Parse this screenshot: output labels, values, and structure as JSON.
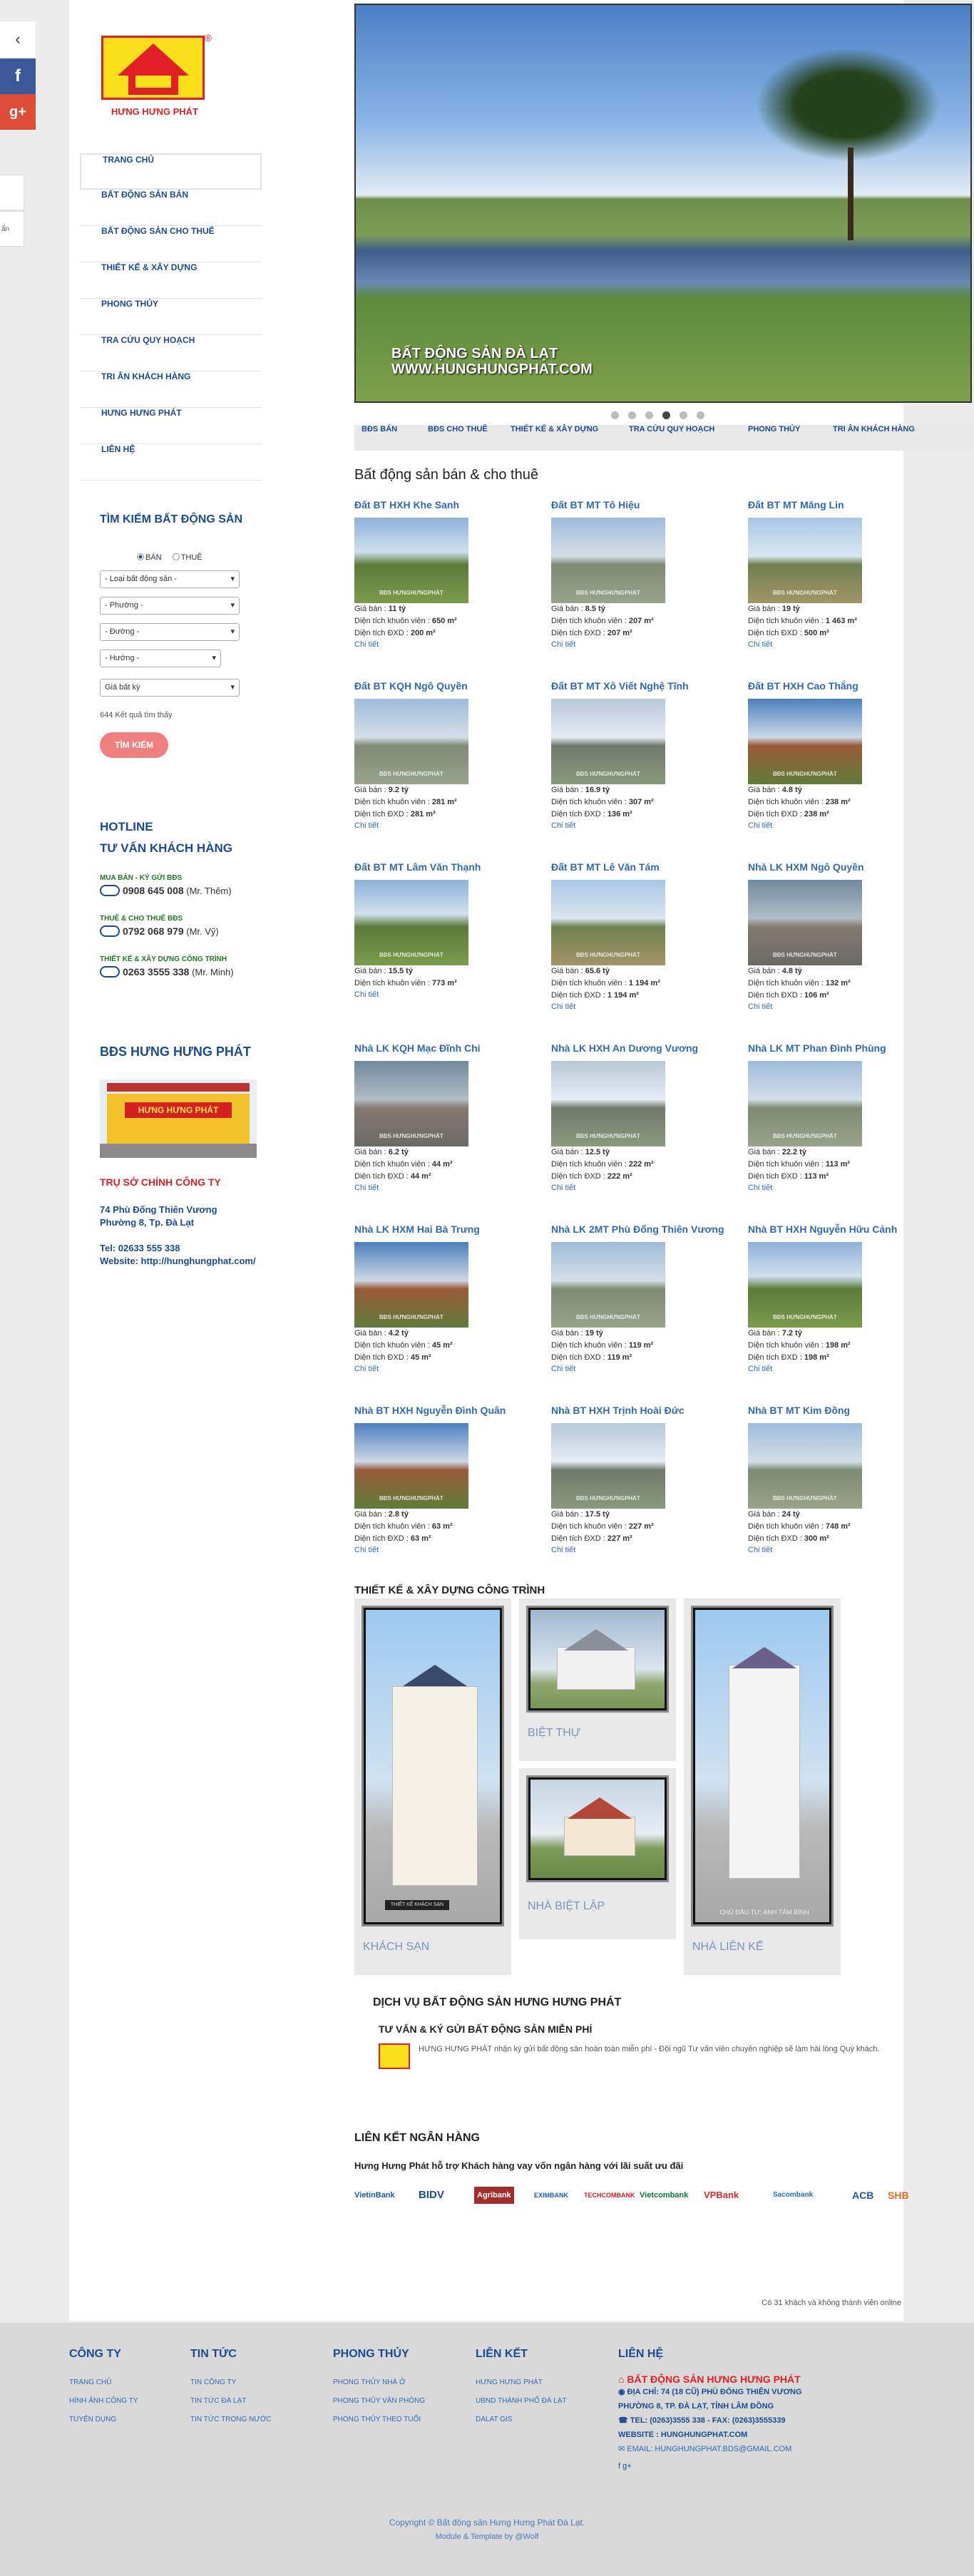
{
  "social": {
    "facebook": "f",
    "googleplus": "g+",
    "arrow": "‹",
    "tab2": "ẩn"
  },
  "logo": {
    "name": "HƯNG HƯNG PHÁT",
    "reg": "®"
  },
  "menu": [
    "TRANG CHỦ",
    "BẤT ĐỘNG SẢN BÁN",
    "BẤT ĐỘNG SẢN CHO THUÊ",
    "THIẾT KẾ & XÂY DỰNG",
    "PHONG THỦY",
    "TRA CỨU QUY HOẠCH",
    "TRI ÂN KHÁCH HÀNG",
    "HƯNG HƯNG PHÁT",
    "LIÊN HỆ"
  ],
  "search": {
    "title": "TÌM KIẾM BẤT ĐỘNG SẢN",
    "radio_ban": "BÁN",
    "radio_thue": "THUÊ",
    "type": "- Loại bất động sản -",
    "ward": "- Phường -",
    "street": "- Đường -",
    "direction": "- Hướng -",
    "price": "Giá bất kỳ",
    "results": "644 Kết quả tìm thấy",
    "button": "TÌM KIẾM"
  },
  "hotline": {
    "title1": "HOTLINE",
    "title2": "TƯ VẤN KHÁCH HÀNG",
    "g1_label": "MUA BÁN - KÝ GỬI BĐS",
    "g1_phone": "0908 645 008",
    "g1_name": "(Mr. Thêm)",
    "g2_label": "THUÊ & CHO THUÊ BĐS",
    "g2_phone": "0792 068 979",
    "g2_name": "(Mr. Vỹ)",
    "g3_label": "THIẾT KẾ & XÂY DỰNG CÔNG TRÌNH",
    "g3_phone": "0263 3555 338",
    "g3_name": "(Mr. Minh)"
  },
  "company": {
    "title": "BĐS HƯNG HƯNG PHÁT",
    "shop_sign": "HƯNG HƯNG PHÁT",
    "hq_title": "TRỤ SỞ CHÍNH CÔNG TY",
    "addr1": "74 Phù Đổng Thiên Vương",
    "addr2": "Phường 8, Tp. Đà Lạt",
    "tel": "Tel: 02633 555 338",
    "web": "Website: http://hunghungphat.com/"
  },
  "slider": {
    "caption1": "BẤT ĐỘNG SẢN ĐÀ LẠT",
    "caption2": "WWW.HUNGHUNGPHAT.COM",
    "active": 4,
    "count": 6
  },
  "catbar": [
    "BĐS BÁN",
    "BĐS CHO THUÊ",
    "THIẾT KẾ & XÂY DỰNG",
    "TRA CỨU QUY HOẠCH",
    "PHONG THỦY",
    "TRI ÂN KHÁCH HÀNG"
  ],
  "section_title": "Bất động sản bán & cho thuê",
  "labels": {
    "price": "Giá bán : ",
    "area": "Diện tích khuôn viên : ",
    "build": "Diện tích ĐXD : ",
    "more": "Chi tiết",
    "wm": "BĐS HƯNGHƯNGPHÁT"
  },
  "properties": [
    {
      "title": "Đất BT HXH Khe Sanh",
      "price": "11 tỷ",
      "area": "650 m²",
      "build": "200 m²",
      "img": "g1"
    },
    {
      "title": "Đất BT MT Tô Hiệu",
      "price": "8.5 tỷ",
      "area": "207 m²",
      "build": "207 m²",
      "img": "g2"
    },
    {
      "title": "Đất BT MT Măng Lin",
      "price": "19 tỷ",
      "area": "1 463 m²",
      "build": "500 m²",
      "img": "g3"
    },
    {
      "title": "Đất BT KQH Ngô Quyền",
      "price": "9.2 tỷ",
      "area": "281 m²",
      "build": "281 m²",
      "img": "g2"
    },
    {
      "title": "Đất BT MT Xô Viết Nghệ Tĩnh",
      "price": "16.9 tỷ",
      "area": "307 m²",
      "build": "136 m²",
      "img": "g5"
    },
    {
      "title": "Đất BT HXH Cao Thắng",
      "price": "4.8 tỷ",
      "area": "238 m²",
      "build": "238 m²",
      "img": "g4"
    },
    {
      "title": "Đất BT MT Lâm Văn Thạnh",
      "price": "15.5 tỷ",
      "area": "773 m²",
      "build": "",
      "img": "g1"
    },
    {
      "title": "Đất BT MT Lê Văn Tám",
      "price": "65.6 tỷ",
      "area": "1 194 m²",
      "build": "1 194 m²",
      "img": "g3"
    },
    {
      "title": "Nhà LK HXM Ngô Quyền",
      "price": "4.8 tỷ",
      "area": "132 m²",
      "build": "106 m²",
      "img": "g6"
    },
    {
      "title": "Nhà LK KQH Mạc Đĩnh Chi",
      "price": "6.2 tỷ",
      "area": "44 m²",
      "build": "44 m²",
      "img": "g6"
    },
    {
      "title": "Nhà LK HXH An Dương Vương",
      "price": "12.5 tỷ",
      "area": "222 m²",
      "build": "222 m²",
      "img": "g5"
    },
    {
      "title": "Nhà LK MT Phan Đình Phùng",
      "price": "22.2 tỷ",
      "area": "113 m²",
      "build": "113 m²",
      "img": "g2"
    },
    {
      "title": "Nhà LK HXM Hai Bà Trưng",
      "price": "4.2 tỷ",
      "area": "45 m²",
      "build": "45 m²",
      "img": "g4"
    },
    {
      "title": "Nhà LK 2MT Phù Đổng Thiên Vương",
      "price": "19 tỷ",
      "area": "119 m²",
      "build": "119 m²",
      "img": "g2"
    },
    {
      "title": "Nhà BT HXH Nguyễn Hữu Cảnh",
      "price": "7.2 tỷ",
      "area": "198 m²",
      "build": "198 m²",
      "img": "g1"
    },
    {
      "title": "Nhà BT HXH Nguyễn Đình Quân",
      "price": "2.8 tỷ",
      "area": "63 m²",
      "build": "63 m²",
      "img": "g4"
    },
    {
      "title": "Nhà BT HXH Trịnh Hoài Đức",
      "price": "17.5 tỷ",
      "area": "227 m²",
      "build": "227 m²",
      "img": "g5"
    },
    {
      "title": "Nhà BT MT Kim Đồng",
      "price": "24 tỷ",
      "area": "748 m²",
      "build": "300 m²",
      "img": "g2"
    }
  ],
  "design": {
    "title": "THIẾT KẾ & XÂY DỰNG CÔNG TRÌNH",
    "items": [
      "KHÁCH SẠN",
      "BIỆT THỰ",
      "NHÀ BIỆT LẬP",
      "NHÀ LIÊN KẾ"
    ],
    "plate1": "THIẾT KẾ KHÁCH SẠN",
    "plate2": "CHỦ ĐẦU TƯ: ANH TÂM BÌNH"
  },
  "service": {
    "h1": "DỊCH VỤ BẤT ĐỘNG SẢN HƯNG HƯNG PHÁT",
    "h2": "TƯ VẤN & KÝ GỬI BẤT ĐỘNG SẢN MIỄN PHÍ",
    "body": "HƯNG HƯNG PHÁT nhận ký gửi bất động sản hoàn toàn miễn phí - Đội ngũ Tư vấn viên chuyên nghiệp sẽ làm hài lòng Quý khách."
  },
  "bank": {
    "title": "LIÊN KẾT NGÂN HÀNG",
    "sub": "Hưng Hưng Phát hỗ trợ Khách hàng vay vốn ngân hàng với lãi suất ưu đãi",
    "logos": [
      "VietinBank",
      "BIDV",
      "Agribank",
      "EXIMBANK",
      "TECHCOMBANK",
      "Vietcombank",
      "VPBank",
      "Sacombank",
      "ACB",
      "SHB"
    ]
  },
  "online": "Có 31 khách và không thành viên online",
  "footer": {
    "c1_title": "CÔNG TY",
    "c1": [
      "TRANG CHỦ",
      "HÌNH ẢNH CÔNG TY",
      "TUYỂN DỤNG"
    ],
    "c2_title": "TIN TỨC",
    "c2": [
      "TIN CÔNG TY",
      "TIN TỨC ĐÀ LẠT",
      "TIN TỨC TRONG NƯỚC"
    ],
    "c3_title": "PHONG THỦY",
    "c3": [
      "PHONG THỦY NHÀ Ở",
      "PHONG THỦY VĂN PHÒNG",
      "PHONG THỦY THEO TUỔI"
    ],
    "c4_title": "LIÊN KẾT",
    "c4": [
      "HƯNG HƯNG PHÁT",
      "UBND THÀNH PHỐ ĐÀ LẠT",
      "DALAT GIS"
    ],
    "c5_title": "LIÊN HỆ",
    "c5_name": "BẤT ĐỘNG SẢN HƯNG HƯNG PHÁT",
    "c5_addr1": "◉ ĐỊA CHỈ: 74 (18 CŨ) PHÙ ĐỔNG THIÊN VƯƠNG",
    "c5_addr2": "PHƯỜNG 8, TP. ĐÀ LẠT, TỈNH LÂM ĐỒNG",
    "c5_tel": "☎ TEL: (0263)3555 338 - FAX: (0263)3555339",
    "c5_web": "WEBSITE : HUNGHUNGPHAT.COM",
    "c5_email": "✉ EMAIL: HUNGHUNGPHAT.BDS@GMAIL.COM",
    "c5_social": "f  g+",
    "copyright": "Copyright © Bất động sản Hưng Hưng Phát Đà Lạt.",
    "module": "Module & Template by @Wolf"
  }
}
